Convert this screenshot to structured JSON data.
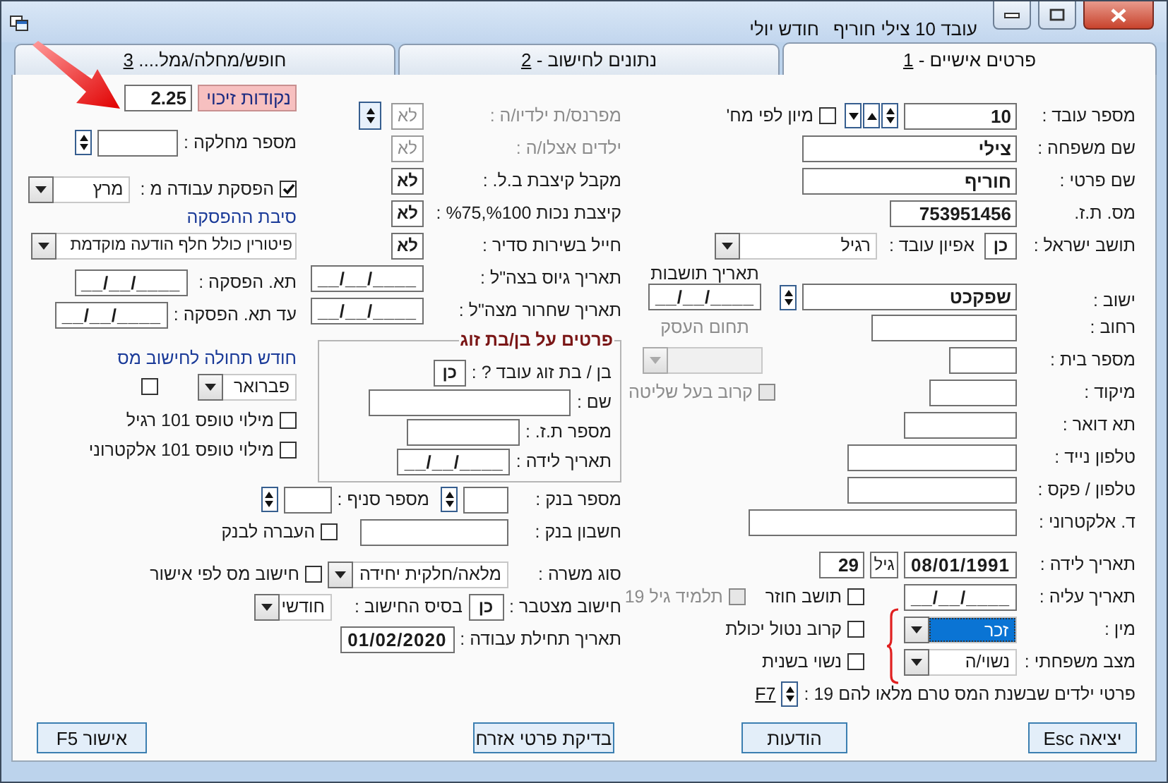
{
  "window": {
    "title": "עובד 10 צילי חוריף",
    "subtitle": "חודש יולי"
  },
  "tabs": [
    {
      "label": "פרטים אישיים - ",
      "key": "1",
      "selected": true
    },
    {
      "label": "נתונים לחישוב - ",
      "key": "2",
      "selected": false
    },
    {
      "label": "חופש/מחלה/גמל.... ",
      "key": "3",
      "selected": false
    }
  ],
  "personal": {
    "rows": [
      {
        "label": "מספר עובד :",
        "controls": [
          {
            "kind": "field",
            "value": "10"
          },
          {
            "kind": "spin"
          },
          {
            "kind": "up"
          },
          {
            "kind": "down"
          },
          {
            "kind": "checkbox",
            "label": "מיון לפי מח'",
            "checked": false,
            "disabled": false
          }
        ]
      },
      {
        "label": "שם משפחה :",
        "controls": [
          {
            "kind": "field",
            "value": "צילי"
          }
        ]
      },
      {
        "label": "שם פרטי :",
        "controls": [
          {
            "kind": "field",
            "value": "חוריף"
          }
        ]
      },
      {
        "label": "מס. ת.ז.",
        "controls": [
          {
            "kind": "field",
            "value": "753951456"
          }
        ]
      },
      {
        "label": "תושב ישראל :",
        "controls": [
          {
            "kind": "toggle",
            "value": "כן",
            "disabled": false
          },
          {
            "kind": "text",
            "text": "אפיון עובד :"
          },
          {
            "kind": "dropdown",
            "value": "רגיל",
            "selected": false,
            "disabled": false
          }
        ]
      },
      {
        "label": "ישוב :",
        "controls": [
          {
            "kind": "field",
            "value": "שפקכט"
          },
          {
            "kind": "spin"
          },
          {
            "kind": "date",
            "caption": "תאריך תושבות",
            "value": "__/__/____"
          }
        ]
      },
      {
        "label": "רחוב :",
        "controls": [
          {
            "kind": "field"
          },
          {
            "kind": "text",
            "text": "תחום העסק",
            "disabled": true
          }
        ]
      },
      {
        "label": "מספר בית :",
        "controls": [
          {
            "kind": "field"
          },
          {
            "kind": "dropdown",
            "selected": false,
            "disabled": true
          }
        ]
      },
      {
        "label": "מיקוד :",
        "controls": [
          {
            "kind": "field"
          },
          {
            "kind": "checkbox",
            "label": "קרוב בעל שליטה",
            "checked": false,
            "disabled": true
          }
        ]
      },
      {
        "label": "תא דואר :",
        "controls": [
          {
            "kind": "field"
          }
        ]
      },
      {
        "label": "טלפון נייד :",
        "controls": [
          {
            "kind": "field"
          }
        ]
      },
      {
        "label": "טלפון / פקס :",
        "controls": [
          {
            "kind": "field"
          }
        ]
      },
      {
        "label": "ד. אלקטרוני :",
        "controls": [
          {
            "kind": "field"
          }
        ]
      },
      {
        "label": "תאריך לידה :",
        "controls": [
          {
            "kind": "date",
            "value": "08/01/1991"
          },
          {
            "kind": "tag",
            "text": "גיל"
          },
          {
            "kind": "field",
            "value": "29"
          }
        ]
      },
      {
        "label": "תאריך עליה :",
        "controls": [
          {
            "kind": "date",
            "value": "__/__/____"
          },
          {
            "kind": "checkbox",
            "label": "תושב חוזר",
            "checked": false,
            "disabled": false
          },
          {
            "kind": "checkbox",
            "label": "תלמיד גיל 19",
            "checked": false,
            "disabled": true
          }
        ]
      },
      {
        "label": "מין :",
        "controls": [
          {
            "kind": "dropdown",
            "value": "זכר",
            "selected": true,
            "disabled": false
          },
          {
            "kind": "checkbox",
            "label": "קרוב נטול יכולת",
            "checked": false,
            "disabled": false
          }
        ]
      },
      {
        "label": "מצב משפחתי :",
        "controls": [
          {
            "kind": "dropdown",
            "value": "נשוי/ה",
            "selected": false,
            "disabled": false
          },
          {
            "kind": "checkbox",
            "label": "נשוי בשנית",
            "checked": false,
            "disabled": false
          }
        ]
      },
      {
        "label": "פרטי ילדים שבשנת המס טרם מלאו להם 19 :",
        "controls": [
          {
            "kind": "spin"
          },
          {
            "kind": "link",
            "text": "F7"
          }
        ]
      }
    ]
  },
  "middle": {
    "rows": [
      {
        "label": "מפרנס/ת ילדיו/ה :",
        "disabled": true,
        "controls": [
          {
            "kind": "toggle",
            "value": "לא",
            "disabled": true
          },
          {
            "kind": "spin"
          }
        ]
      },
      {
        "label": "ילדים אצלו/ה :",
        "disabled": true,
        "controls": [
          {
            "kind": "toggle",
            "value": "לא",
            "disabled": true
          }
        ]
      },
      {
        "label": "מקבל קיצבת ב.ל. :",
        "disabled": false,
        "controls": [
          {
            "kind": "toggle",
            "value": "לא",
            "disabled": false
          }
        ]
      },
      {
        "label": "קיצבת נכות %100,%75 :",
        "disabled": false,
        "controls": [
          {
            "kind": "toggle",
            "value": "לא",
            "disabled": false
          }
        ]
      },
      {
        "label": "חייל בשירות סדיר :",
        "disabled": false,
        "controls": [
          {
            "kind": "toggle",
            "value": "לא",
            "disabled": false
          }
        ]
      },
      {
        "label": "תאריך גיוס בצה\"ל :",
        "disabled": false,
        "controls": [
          {
            "kind": "date",
            "value": "__/__/____"
          }
        ]
      },
      {
        "label": "תאריך שחרור מצה\"ל :",
        "disabled": false,
        "controls": [
          {
            "kind": "date",
            "value": "__/__/____"
          }
        ]
      }
    ]
  },
  "spouse": {
    "title": "פרטים על בן/בת זוג",
    "rows": [
      {
        "label": "בן / בת זוג עובד ? :",
        "controls": [
          {
            "kind": "toggle",
            "value": "כן",
            "disabled": false
          }
        ]
      },
      {
        "label": "שם :",
        "controls": [
          {
            "kind": "field"
          }
        ]
      },
      {
        "label": "מספר ת.ז. :",
        "controls": [
          {
            "kind": "field"
          }
        ]
      },
      {
        "label": "תאריך לידה :",
        "controls": [
          {
            "kind": "date",
            "value": "__/__/____"
          }
        ]
      }
    ]
  },
  "left": {
    "rows": [
      {
        "label": "נקודות זיכוי",
        "controls": [
          {
            "kind": "field",
            "value": "2.25"
          }
        ]
      },
      {
        "label": "מספר מחלקה :",
        "controls": [
          {
            "kind": "field"
          },
          {
            "kind": "spin"
          }
        ]
      },
      {
        "controls": [
          {
            "kind": "checkbox",
            "label": "הפסקת עבודה מ :",
            "checked": true,
            "disabled": false
          },
          {
            "kind": "dropdown",
            "value": "מרץ",
            "selected": false,
            "disabled": false
          }
        ]
      },
      {
        "controls": [
          {
            "kind": "caption",
            "text": "סיבת ההפסקה"
          }
        ]
      },
      {
        "controls": [
          {
            "kind": "dropdown",
            "value": "פיטורין כולל חלף הודעה מוקדמת",
            "selected": false,
            "disabled": false
          }
        ]
      },
      {
        "label": "תא. הפסקה :",
        "controls": [
          {
            "kind": "date",
            "value": "__/__/____"
          }
        ]
      },
      {
        "label": "עד תא. הפסקה :",
        "controls": [
          {
            "kind": "date",
            "value": "__/__/____"
          }
        ]
      },
      {
        "controls": [
          {
            "kind": "caption",
            "text": "חודש תחולה לחישוב מס"
          }
        ]
      },
      {
        "controls": [
          {
            "kind": "dropdown",
            "value": "פברואר",
            "selected": false,
            "disabled": false
          },
          {
            "kind": "checkbox",
            "checked": false,
            "disabled": false
          }
        ]
      },
      {
        "controls": [
          {
            "kind": "checkbox",
            "label": "מילוי טופס 101 רגיל",
            "checked": false,
            "disabled": false
          }
        ]
      },
      {
        "controls": [
          {
            "kind": "checkbox",
            "label": "מילוי טופס 101 אלקטרוני",
            "checked": false,
            "disabled": false
          }
        ]
      }
    ]
  },
  "bank": {
    "rows": [
      {
        "label": "מספר בנק :",
        "controls": [
          {
            "kind": "field"
          },
          {
            "kind": "spin"
          },
          {
            "kind": "text",
            "text": "מספר סניף :"
          },
          {
            "kind": "field"
          },
          {
            "kind": "spin"
          }
        ]
      },
      {
        "label": "חשבון בנק :",
        "controls": [
          {
            "kind": "field"
          },
          {
            "kind": "checkbox",
            "label": "העברה לבנק",
            "checked": false,
            "disabled": false
          }
        ]
      },
      {
        "label": "סוג משרה :",
        "controls": [
          {
            "kind": "dropdown",
            "value": "מלאה/חלקית יחידה",
            "selected": false,
            "disabled": false
          },
          {
            "kind": "checkbox",
            "label": "חישוב מס לפי אישור",
            "checked": false,
            "disabled": false
          }
        ]
      },
      {
        "label": "חישוב מצטבר :",
        "controls": [
          {
            "kind": "toggle",
            "value": "כן",
            "disabled": false
          },
          {
            "kind": "text",
            "text": "בסיס החישוב :"
          },
          {
            "kind": "dropdown",
            "value": "חודשי",
            "selected": false,
            "disabled": false
          }
        ]
      },
      {
        "label": "תאריך תחילת עבודה :",
        "controls": [
          {
            "kind": "date",
            "value": "01/02/2020"
          }
        ]
      }
    ]
  },
  "buttons": [
    "יציאה Esc",
    "הודעות",
    "בדיקת פרטי אזרח",
    "אישור F5"
  ]
}
